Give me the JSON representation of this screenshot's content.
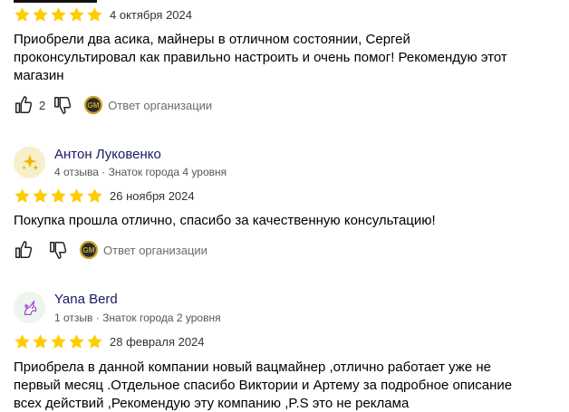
{
  "reviews": [
    {
      "date": "4 октября 2024",
      "rating": 5,
      "text_lines": [
        "Приобрели два асика, майнеры в отличном состоянии, Сергей",
        "проконсультировал как правильно настроить и очень помог! Рекомендую этот",
        "магазин"
      ],
      "likes": "2",
      "org_reply_label": "Ответ организации"
    },
    {
      "author": "Антон Луковенко",
      "meta": "4 отзыва · Знаток города 4 уровня",
      "avatar_icon": "sparkles-icon",
      "date": "26 ноября 2024",
      "rating": 5,
      "text_lines": [
        "Покупка прошла отлично, спасибо за качественную консультацию!"
      ],
      "org_reply_label": "Ответ организации"
    },
    {
      "author": "Yana Berd",
      "meta": "1 отзыв · Знаток города 2 уровня",
      "avatar_icon": "unicorn-icon",
      "date": "28 февраля 2024",
      "rating": 5,
      "text_lines": [
        "Приобрела в данной компании новый вацмайнер ,отлично работает уже не",
        "первый месяц .Отдельное спасибо Виктории и Артему за подробное описание",
        "всех действий ,Рекомендую эту компанию ,P.S это не реклама"
      ]
    }
  ],
  "colors": {
    "star": "#ffcc00",
    "author": "#1a1a66",
    "badge": "#c9a227"
  }
}
